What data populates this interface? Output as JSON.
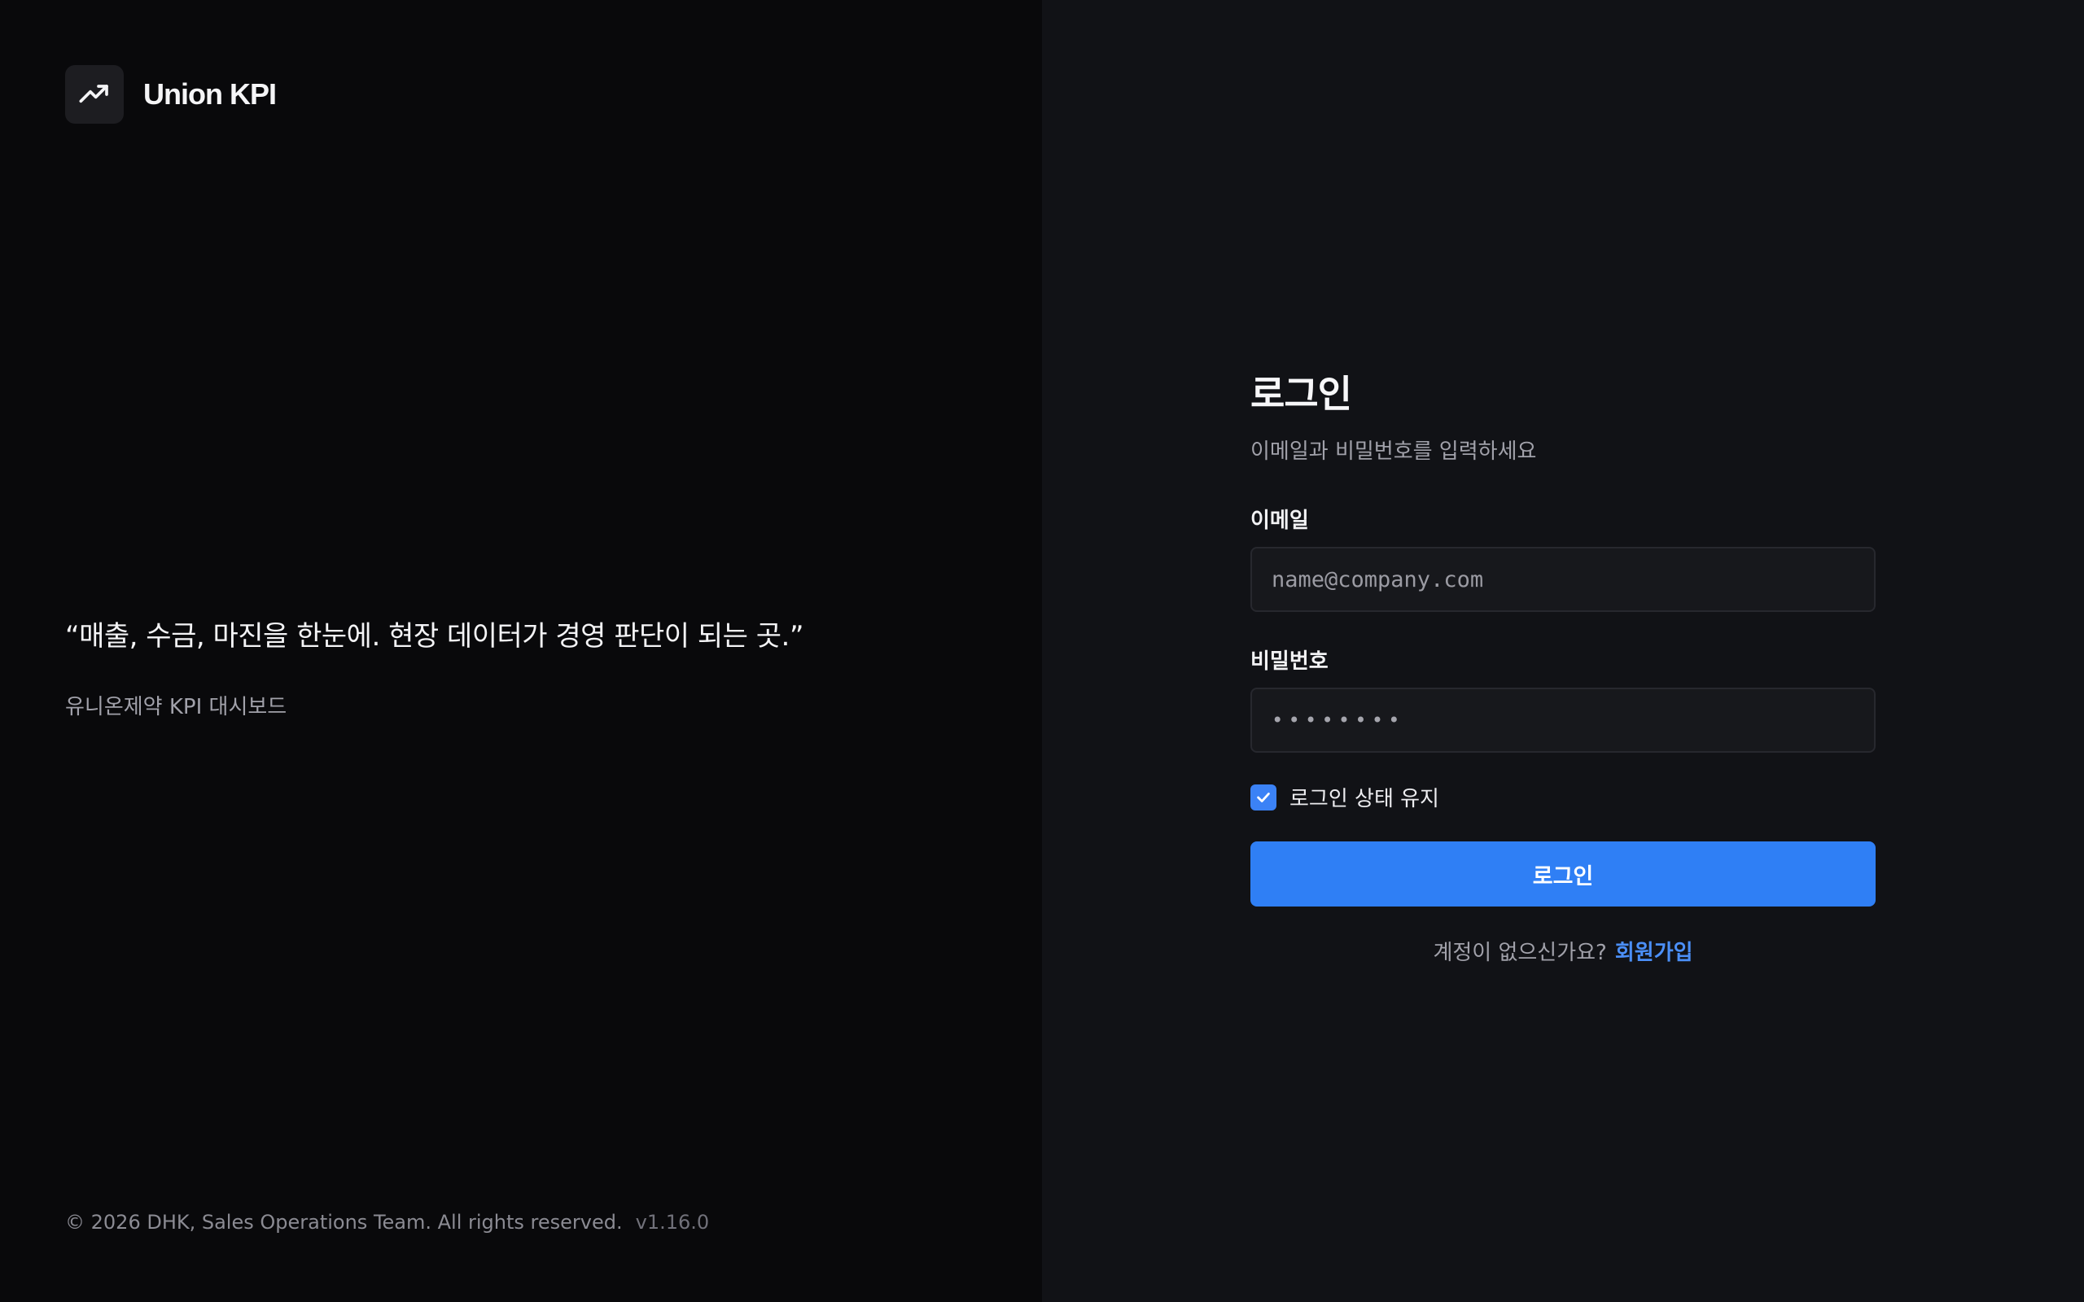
{
  "brand": {
    "name": "Union KPI",
    "icon": "trending-up-icon"
  },
  "hero": {
    "quote": "“매출, 수금, 마진을 한눈에. 현장 데이터가 경영 판단이 되는 곳.”",
    "subtitle": "유니온제약 KPI 대시보드"
  },
  "footer": {
    "copyright": "© 2026 DHK, Sales Operations Team. All rights reserved.",
    "version": "v1.16.0"
  },
  "login": {
    "title": "로그인",
    "subtitle": "이메일과 비밀번호를 입력하세요",
    "email_label": "이메일",
    "email_placeholder": "name@company.com",
    "email_value": "",
    "password_label": "비밀번호",
    "password_value": "••••••••",
    "remember_label": "로그인 상태 유지",
    "remember_checked": true,
    "submit_label": "로그인",
    "signup_prompt": "계정이 없으신가요?",
    "signup_link": "회원가입"
  },
  "colors": {
    "accent": "#2f7ff5",
    "link": "#4b8ff7",
    "left_bg": "#09090b",
    "right_bg": "#111216"
  }
}
